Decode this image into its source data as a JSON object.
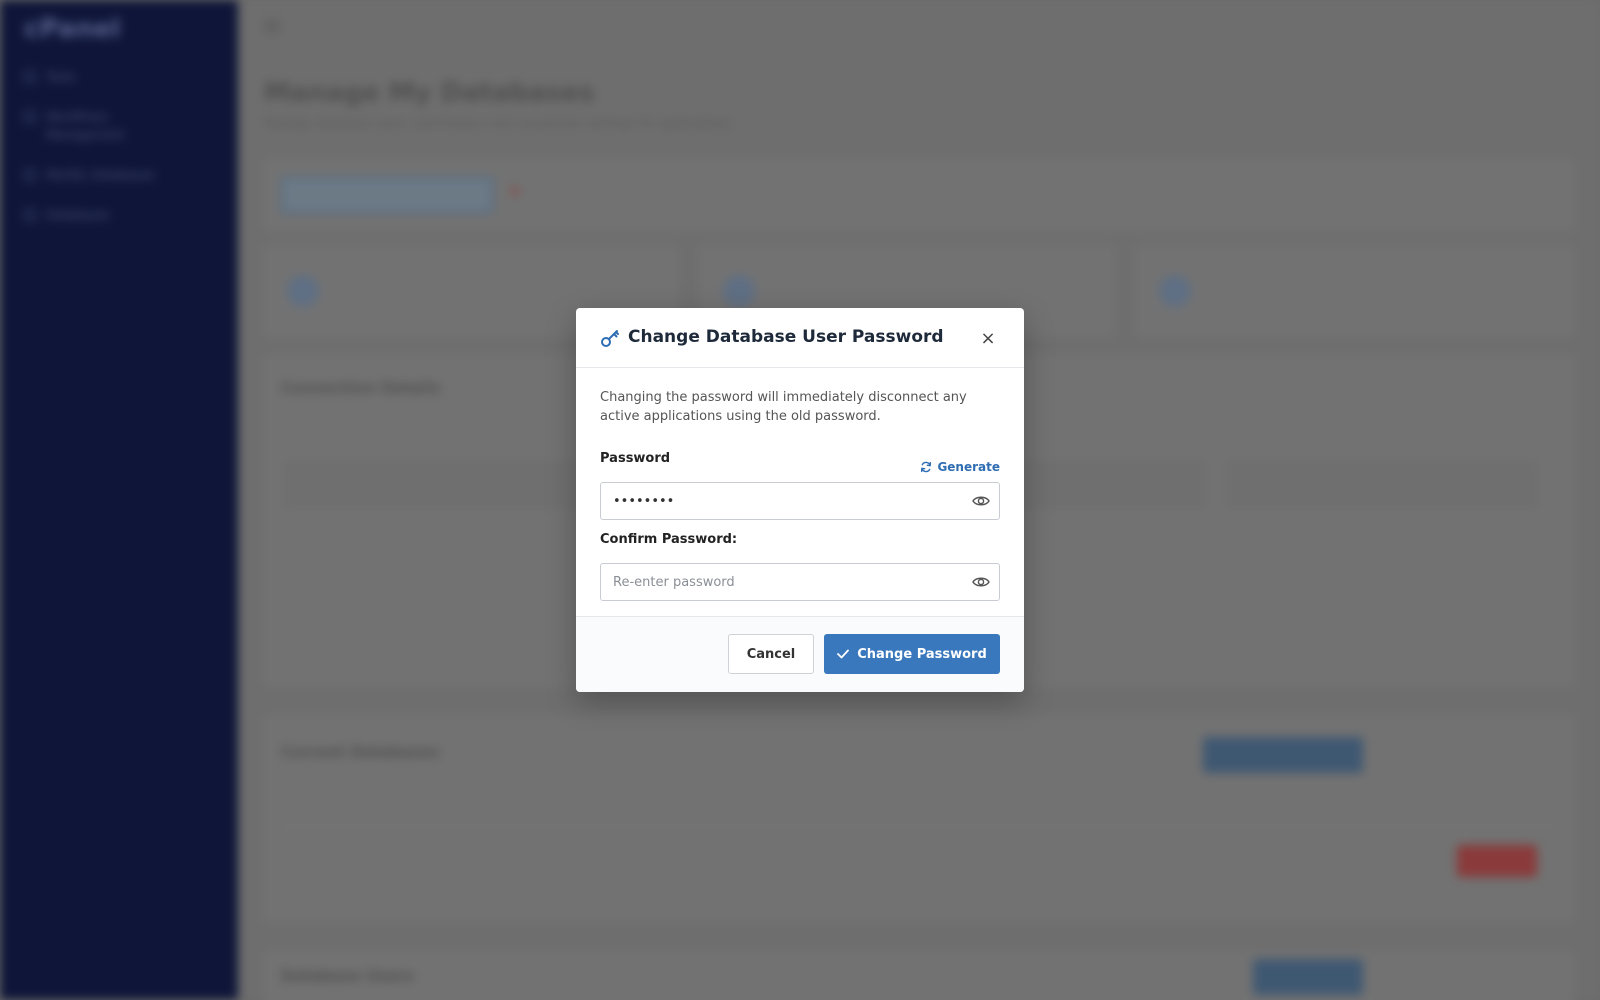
{
  "background": {
    "logo": "cPanel",
    "nav_items": [
      "Tools",
      "WordPress Management",
      "MySQL Databases",
      "Databases"
    ],
    "title": "Manage My Databases",
    "subtitle": "Manage database users, permissions and connection settings for applications",
    "sections": {
      "connection": "Connection Details",
      "current_databases": "Current Databases",
      "database_users": "Database Users"
    }
  },
  "modal": {
    "title": "Change Database User Password",
    "icon": "key-icon",
    "close_label": "×",
    "note": "Changing the password will immediately disconnect any active applications using the old password.",
    "password": {
      "label": "Password",
      "value": "••••••••",
      "generate_label": "Generate"
    },
    "confirm": {
      "label": "Confirm Password:",
      "placeholder": "Re-enter password"
    },
    "cancel_label": "Cancel",
    "submit_label": "Change Password"
  },
  "colors": {
    "accent": "#3a78bd",
    "link": "#2f6db3",
    "sidebar": "#0e1538"
  }
}
